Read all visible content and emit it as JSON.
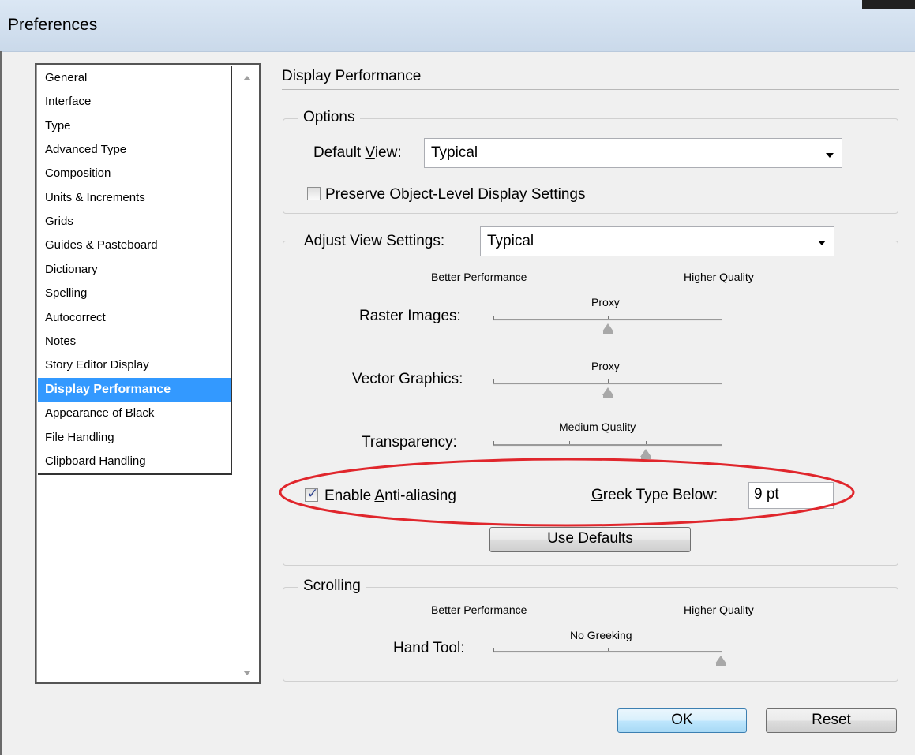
{
  "window": {
    "title": "Preferences"
  },
  "sidebar": {
    "items": [
      {
        "label": "General"
      },
      {
        "label": "Interface"
      },
      {
        "label": "Type"
      },
      {
        "label": "Advanced Type"
      },
      {
        "label": "Composition"
      },
      {
        "label": "Units & Increments"
      },
      {
        "label": "Grids"
      },
      {
        "label": "Guides & Pasteboard"
      },
      {
        "label": "Dictionary"
      },
      {
        "label": "Spelling"
      },
      {
        "label": "Autocorrect"
      },
      {
        "label": "Notes"
      },
      {
        "label": "Story Editor Display"
      },
      {
        "label": "Display Performance"
      },
      {
        "label": "Appearance of Black"
      },
      {
        "label": "File Handling"
      },
      {
        "label": "Clipboard Handling"
      }
    ],
    "selected": "Display Performance"
  },
  "panel": {
    "title": "Display Performance",
    "options": {
      "group_label": "Options",
      "default_view_label_pre": "Default ",
      "default_view_label_ul": "V",
      "default_view_label_post": "iew:",
      "default_view_value": "Typical",
      "preserve_ul": "P",
      "preserve_rest": "reserve Object-Level Display Settings",
      "preserve_checked": false
    },
    "adjust": {
      "label_pre": "Ad",
      "label_ul": "j",
      "label_post": "ust View Settings:",
      "value": "Typical",
      "better_performance": "Better Performance",
      "higher_quality": "Higher Quality",
      "sliders": [
        {
          "label": "Raster Images:",
          "value_label": "Proxy",
          "level": 0.5,
          "positions": 3
        },
        {
          "label": "Vector Graphics:",
          "value_label": "Proxy",
          "level": 0.5,
          "positions": 3
        },
        {
          "label": "Transparency:",
          "value_label": "Medium Quality",
          "level": 0.67,
          "positions": 4
        }
      ],
      "anti_alias_pre": "Enable ",
      "anti_alias_ul": "A",
      "anti_alias_post": "nti-aliasing",
      "anti_alias_checked": true,
      "greek_ul": "G",
      "greek_rest": "reek Type Below:",
      "greek_value": "9 pt",
      "use_defaults_ul": "U",
      "use_defaults_rest": "se Defaults"
    },
    "scrolling": {
      "group_label": "Scrolling",
      "better_performance": "Better Performance",
      "higher_quality": "Higher Quality",
      "hand_tool_label": "Hand Tool:",
      "hand_tool_value_label": "No Greeking",
      "level": 1.0,
      "positions": 3
    }
  },
  "buttons": {
    "ok": "OK",
    "reset": "Reset"
  },
  "colors": {
    "selection": "#3399ff",
    "annotation": "#e0262c"
  }
}
